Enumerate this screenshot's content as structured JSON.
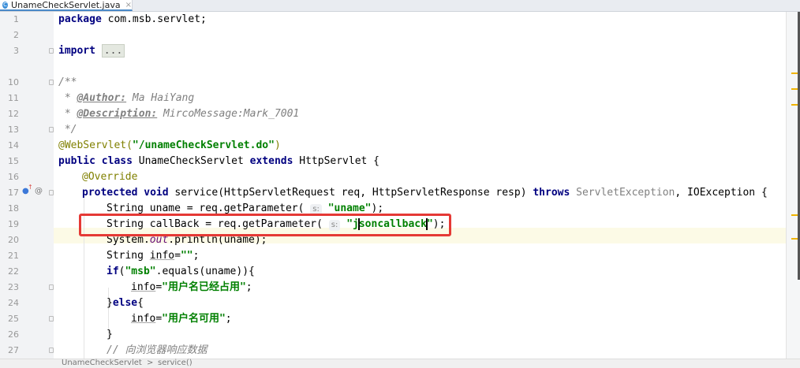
{
  "tab": {
    "icon": "C",
    "title": "UnameCheckServlet.java",
    "close": "×"
  },
  "lines": [
    {
      "n": "1"
    },
    {
      "n": "2"
    },
    {
      "n": "3"
    },
    {
      "n": "10"
    },
    {
      "n": "11"
    },
    {
      "n": "12"
    },
    {
      "n": "13"
    },
    {
      "n": "14"
    },
    {
      "n": "15"
    },
    {
      "n": "16"
    },
    {
      "n": "17"
    },
    {
      "n": "18"
    },
    {
      "n": "19"
    },
    {
      "n": "20"
    },
    {
      "n": "21"
    },
    {
      "n": "22"
    },
    {
      "n": "23"
    },
    {
      "n": "24"
    },
    {
      "n": "25"
    },
    {
      "n": "26"
    },
    {
      "n": "27"
    }
  ],
  "code": {
    "l1_kw": "package",
    "l1_rest": " com.msb.servlet;",
    "l3_kw": "import",
    "l3_fold": "...",
    "l10": "/**",
    "l11_pre": " * ",
    "l11_tag": "@Author:",
    "l11_val": " Ma HaiYang",
    "l12_pre": " * ",
    "l12_tag": "@Description:",
    "l12_val": " MircoMessage:Mark_7001",
    "l13": " */",
    "l14_ann": "@WebServlet(",
    "l14_str": "\"/unameCheckServlet.do\"",
    "l14_end": ")",
    "l15_kw1": "public class",
    "l15_mid": " UnameCheckServlet ",
    "l15_kw2": "extends",
    "l15_end": " HttpServlet {",
    "l16_ann": "@Override",
    "l17_kw": "protected void",
    "l17_mid": " service(HttpServletRequest req, HttpServletResponse resp) ",
    "l17_kw2": "throws",
    "l17_ex": " ServletException",
    "l17_end": ", IOException {",
    "l18_pre": "String uname = req.getParameter(",
    "l18_hint": "s:",
    "l18_str": "\"uname\"",
    "l18_end": ");",
    "l19_pre": "String callBack = req.getParameter(",
    "l19_hint": "s:",
    "l19_str_a": "\"j",
    "l19_str_b": "soncallback",
    "l19_str_c": "\"",
    "l19_end": ");",
    "l20_pre": "System.",
    "l20_fld": "out",
    "l20_end": ".println(uname);",
    "l21_pre": "String ",
    "l21_var": "info",
    "l21_eq": "=",
    "l21_str": "\"\"",
    "l21_end": ";",
    "l22_kw": "if",
    "l22_p": "(",
    "l22_str": "\"msb\"",
    "l22_end": ".equals(uname)){",
    "l23_var": "info",
    "l23_eq": "=",
    "l23_str": "\"用户名已经占用\"",
    "l23_end": ";",
    "l24_a": "}",
    "l24_kw": "else",
    "l24_b": "{",
    "l25_var": "info",
    "l25_eq": "=",
    "l25_str": "\"用户名可用\"",
    "l25_end": ";",
    "l26": "}",
    "l27": "// 向浏览器响应数据"
  },
  "status": {
    "crumb1": "UnameCheckServlet",
    "sep": ">",
    "crumb2": "service()"
  },
  "colors": {
    "highlight_box": "#e53935",
    "keyword": "#000080",
    "string": "#008000"
  }
}
